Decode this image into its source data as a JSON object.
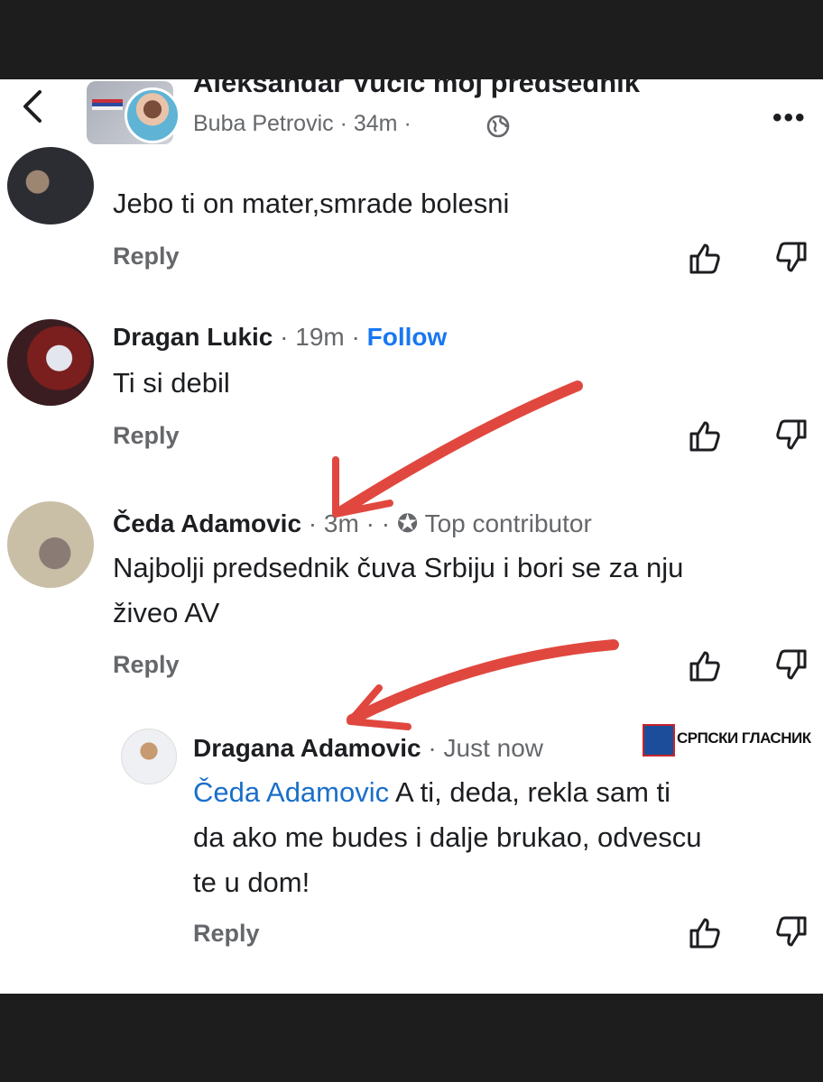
{
  "header": {
    "group_title": "Aleksandar Vucic moj predsednik",
    "poster": "Buba Petrovic",
    "time": "34m"
  },
  "comments": [
    {
      "text": "Jebo ti on mater,smrade bolesni",
      "reply": "Reply"
    },
    {
      "name": "Dragan Lukic",
      "time": "19m",
      "follow": "Follow",
      "text": "Ti si debil",
      "reply": "Reply"
    },
    {
      "name": "Čeda Adamovic",
      "time": "3m",
      "badge": "Top contributor",
      "text_line1": "Najbolji predsednik čuva Srbiju i bori se za nju",
      "text_line2": "živeo AV",
      "reply": "Reply"
    },
    {
      "name": "Dragana Adamovic",
      "time": "Just now",
      "mention": "Čeda Adamovic",
      "text_line1": " A ti, deda, rekla sam ti",
      "text_line2": "da ako me budes i dalje brukao, odvescu",
      "text_line3": "te u dom!",
      "reply": "Reply"
    }
  ],
  "watermark": "СРПСКИ ГЛАСНИК",
  "icons": {
    "back": "back-arrow-icon",
    "globe": "globe-icon",
    "more": "more-options-icon",
    "like": "thumbs-up-icon",
    "dislike": "thumbs-down-icon",
    "badge": "top-contributor-icon"
  },
  "colors": {
    "link": "#1a6fc9",
    "follow": "#1877f2",
    "annotation_arrow": "#e0483f"
  }
}
